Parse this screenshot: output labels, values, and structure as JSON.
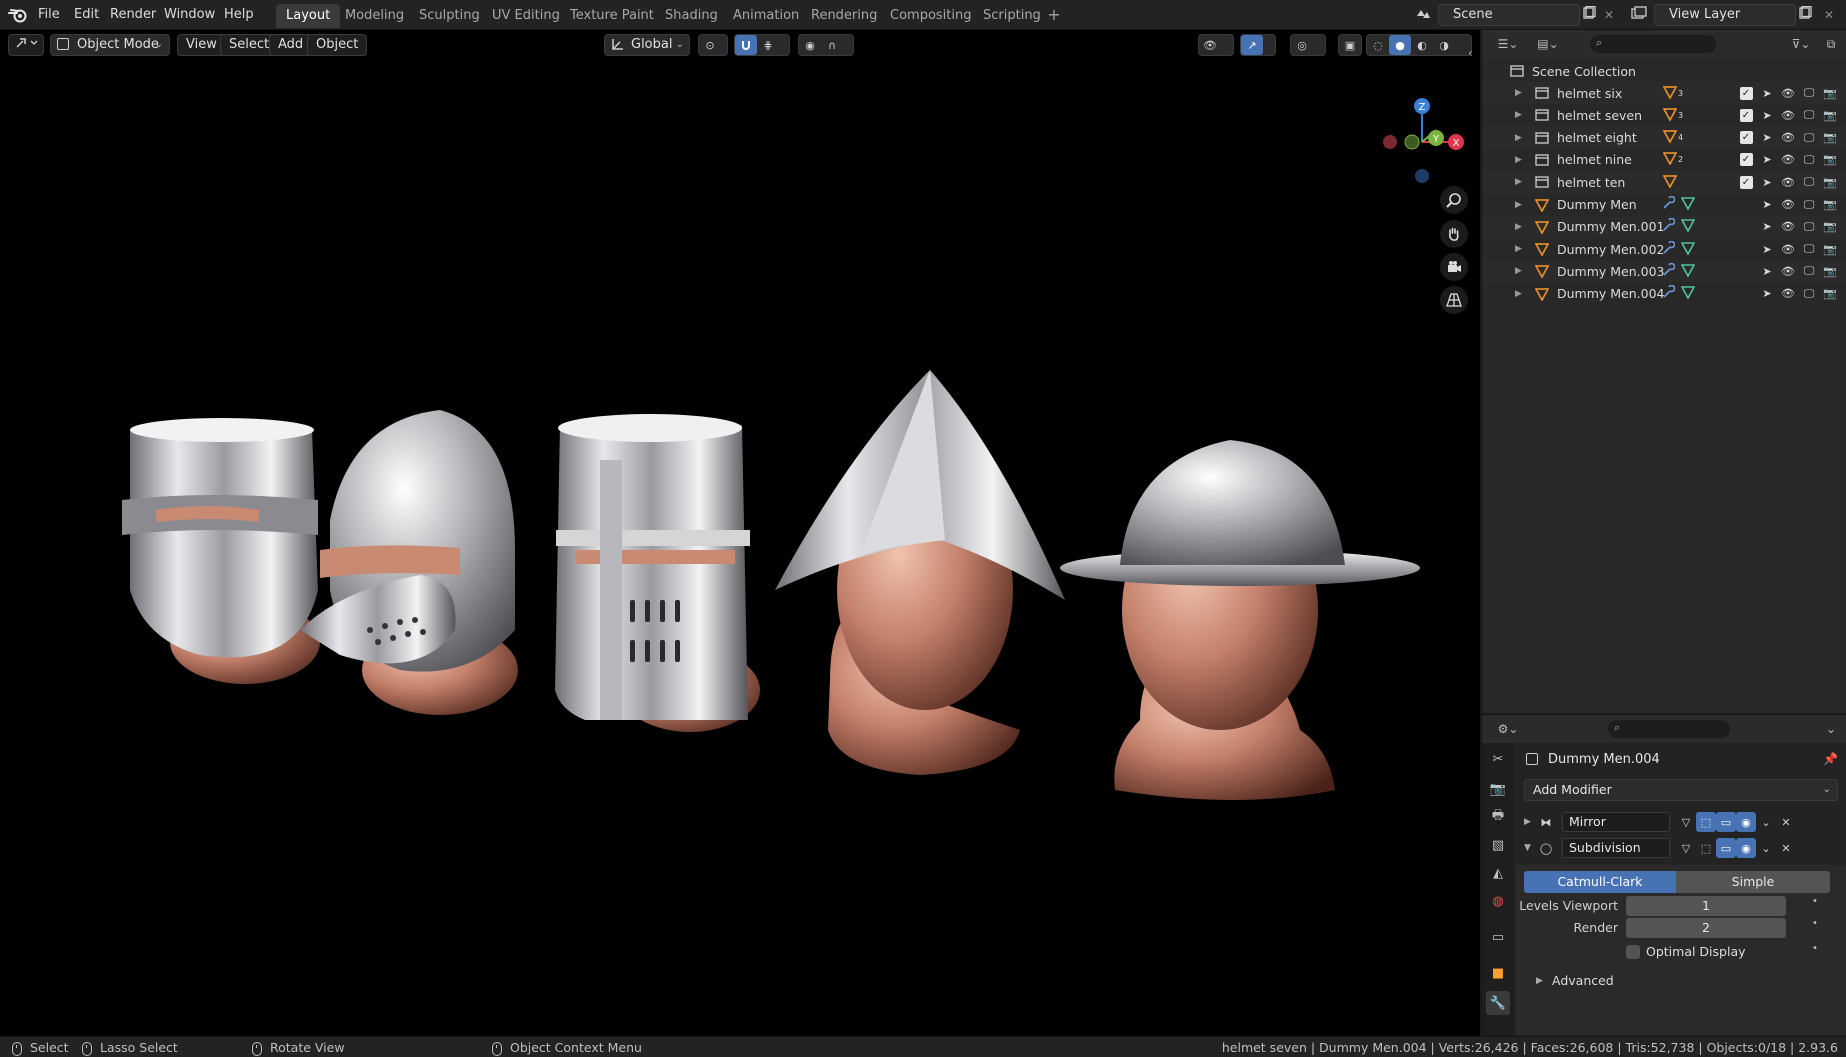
{
  "menus": [
    "File",
    "Edit",
    "Render",
    "Window",
    "Help"
  ],
  "workspaces": [
    "Layout",
    "Modeling",
    "Sculpting",
    "UV Editing",
    "Texture Paint",
    "Shading",
    "Animation",
    "Rendering",
    "Compositing",
    "Scripting"
  ],
  "active_workspace": "Layout",
  "scene_name": "Scene",
  "view_layer": "View Layer",
  "viewport": {
    "mode": "Object Mode",
    "menus": [
      "View",
      "Select",
      "Add",
      "Object"
    ],
    "orientation": "Global",
    "gizmo_axes": {
      "z": "Z",
      "y": "Y",
      "x": "X"
    },
    "axis_colors": {
      "x": "#e0364d",
      "y": "#7bb43a",
      "z": "#3b7fd6"
    }
  },
  "outliner": {
    "root": "Scene Collection",
    "items": [
      {
        "label": "helmet six",
        "type": "collection",
        "badge": "3"
      },
      {
        "label": "helmet seven",
        "type": "collection",
        "badge": "3"
      },
      {
        "label": "helmet eight",
        "type": "collection",
        "badge": "4"
      },
      {
        "label": "helmet nine",
        "type": "collection",
        "badge": "2"
      },
      {
        "label": "helmet ten",
        "type": "collection",
        "badge": ""
      },
      {
        "label": "Dummy Men",
        "type": "object"
      },
      {
        "label": "Dummy Men.001",
        "type": "object"
      },
      {
        "label": "Dummy Men.002",
        "type": "object"
      },
      {
        "label": "Dummy Men.003",
        "type": "object"
      },
      {
        "label": "Dummy Men.004",
        "type": "object"
      }
    ]
  },
  "properties": {
    "object_name": "Dummy Men.004",
    "add_modifier": "Add Modifier",
    "modifiers": [
      {
        "name": "Mirror",
        "expanded": false
      },
      {
        "name": "Subdivision",
        "expanded": true
      }
    ],
    "subdivision": {
      "algorithms": [
        "Catmull-Clark",
        "Simple"
      ],
      "active_algorithm": "Catmull-Clark",
      "levels_viewport_label": "Levels Viewport",
      "levels_viewport": "1",
      "render_label": "Render",
      "render": "2",
      "optimal_display_label": "Optimal Display",
      "advanced_label": "Advanced"
    }
  },
  "statusbar": {
    "select": "Select",
    "lasso": "Lasso Select",
    "rotate": "Rotate View",
    "context": "Object Context Menu",
    "stats": "helmet seven | Dummy Men.004 | Verts:26,426 | Faces:26,608 | Tris:52,738 | Objects:0/18 | 2.93.6"
  },
  "colors": {
    "accent_blue": "#4772b3",
    "object_orange": "#e08a2a",
    "modifier_blue": "#6a9bd8",
    "mesh_green": "#4fc49a"
  }
}
